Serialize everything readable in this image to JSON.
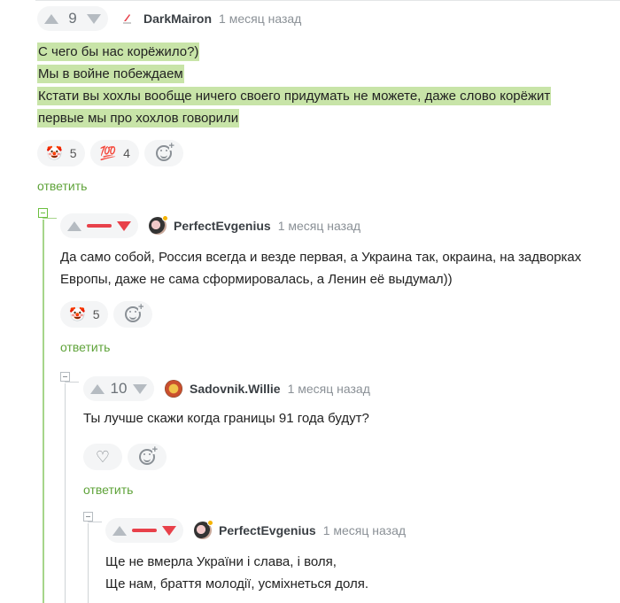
{
  "comments": [
    {
      "score": "9",
      "user": "DarkMairon",
      "time": "1 месяц назад",
      "lines": [
        "С чего бы нас корёжило?)",
        "Мы в войне побеждаем",
        "Кстати вы хохлы вообще ничего своего придумать не можете, даже слово корёжит",
        "первые мы про хохлов говорили"
      ],
      "reactions": [
        {
          "icon": "clown-face-emoji",
          "glyph": "🤡",
          "count": "5"
        },
        {
          "icon": "hundred-points-emoji",
          "glyph": "💯",
          "count": "4"
        }
      ],
      "reply": "ответить"
    },
    {
      "score": "",
      "user": "PerfectEvgenius",
      "time": "1 месяц назад",
      "lines": [
        "Да само собой, Россия всегда и везде первая, а Украина так, окраина, на задворках",
        "Европы, даже не сама сформировалась, а Ленин её выдумал))"
      ],
      "reactions": [
        {
          "icon": "clown-face-emoji",
          "glyph": "🤡",
          "count": "5"
        }
      ],
      "reply": "ответить"
    },
    {
      "score": "10",
      "user": "Sadovnik.Willie",
      "time": "1 месяц назад",
      "lines": [
        "Ты лучше скажи когда границы 91 года будут?"
      ],
      "reactions": [],
      "reply": "ответить"
    },
    {
      "score": "",
      "user": "PerfectEvgenius",
      "time": "1 месяц назад",
      "lines": [
        "Ще не вмерла України і слава, і воля,",
        "Ще нам, браття молодії, усміхнеться доля."
      ],
      "reactions": [],
      "reply": ""
    }
  ],
  "colors": {
    "accent_green": "#5fa33a",
    "highlight": "#c8e4a8",
    "downvote_red": "#e8414a"
  }
}
